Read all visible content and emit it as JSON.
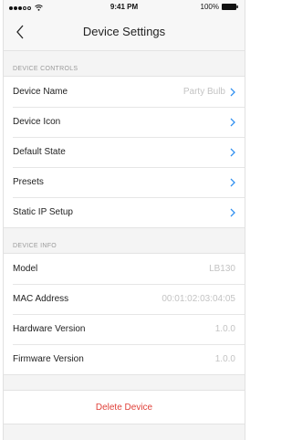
{
  "status_bar": {
    "time": "9:41 PM",
    "battery": "100%"
  },
  "nav": {
    "title": "Device Settings",
    "back_icon": "chevron-left-icon"
  },
  "device_controls": {
    "header": "DEVICE CONTROLS",
    "items": [
      {
        "label": "Device Name",
        "value": "Party Bulb"
      },
      {
        "label": "Device Icon",
        "value": ""
      },
      {
        "label": "Default State",
        "value": ""
      },
      {
        "label": "Presets",
        "value": ""
      },
      {
        "label": "Static IP Setup",
        "value": ""
      }
    ]
  },
  "device_info": {
    "header": "DEVICE INFO",
    "items": [
      {
        "label": "Model",
        "value": "LB130"
      },
      {
        "label": "MAC Address",
        "value": "00:01:02:03:04:05"
      },
      {
        "label": "Hardware Version",
        "value": "1.0.0"
      },
      {
        "label": "Firmware Version",
        "value": "1.0.0"
      }
    ]
  },
  "actions": {
    "delete_label": "Delete Device"
  },
  "colors": {
    "accent": "#2f8ff0",
    "destructive": "#e0413a",
    "secondary_text": "#c3c3c3",
    "section_header": "#9a9a9a",
    "background": "#f4f4f4"
  }
}
